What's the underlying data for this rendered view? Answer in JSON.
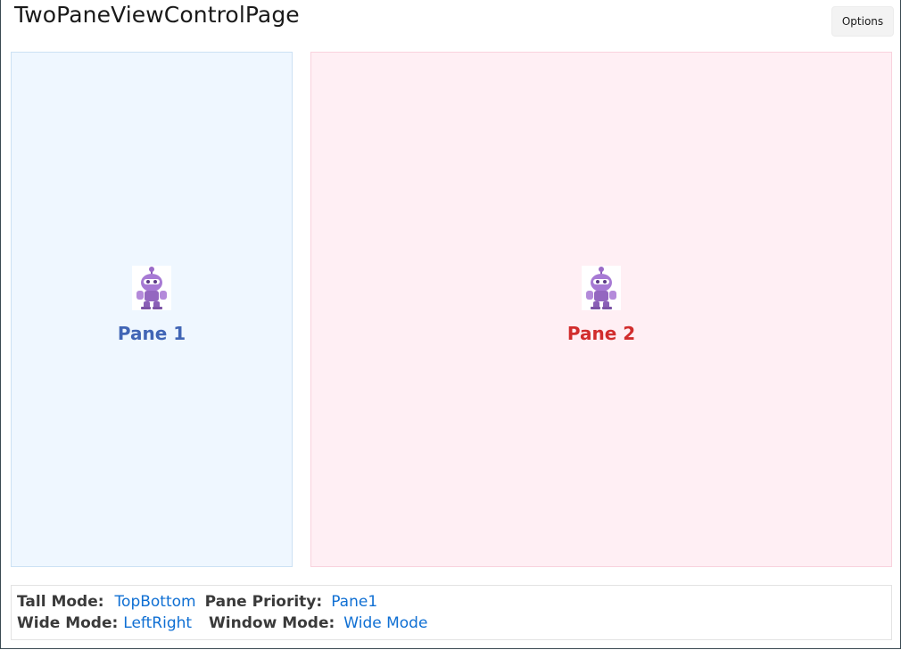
{
  "header": {
    "title": "TwoPaneViewControlPage",
    "options_label": "Options"
  },
  "panes": {
    "pane1": {
      "label": "Pane 1",
      "icon": "robot-mascot-icon"
    },
    "pane2": {
      "label": "Pane 2",
      "icon": "robot-mascot-icon"
    }
  },
  "status": {
    "tall_mode_label": "Tall Mode:",
    "tall_mode_value": "TopBottom",
    "pane_priority_label": "Pane Priority:",
    "pane_priority_value": "Pane1",
    "wide_mode_label": "Wide Mode:",
    "wide_mode_value": "LeftRight",
    "window_mode_label": "Window Mode:",
    "window_mode_value": "Wide Mode"
  },
  "colors": {
    "pane1_bg": "#eff7ff",
    "pane2_bg": "#ffeff4",
    "pane1_text": "#4165b5",
    "pane2_text": "#d12d2d",
    "value_link": "#0f6fd3"
  }
}
